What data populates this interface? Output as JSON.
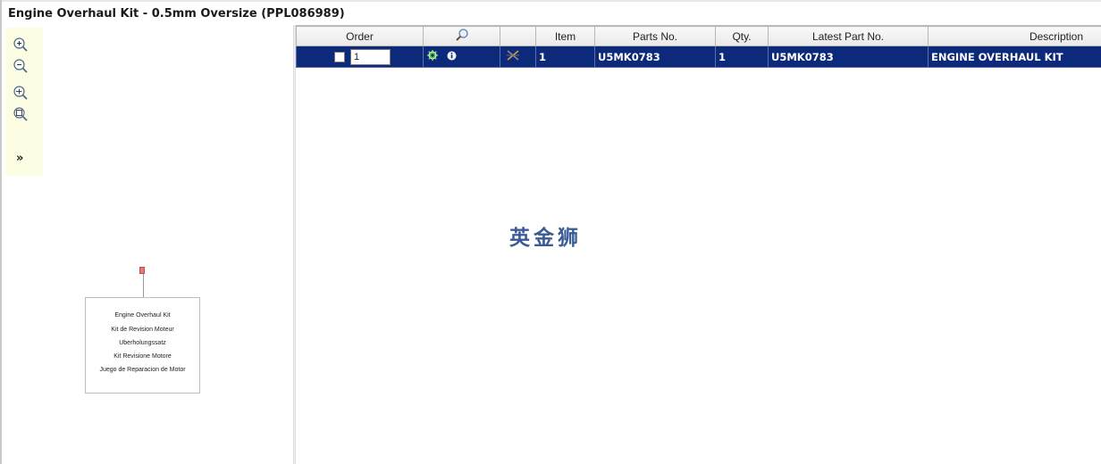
{
  "title": "Engine Overhaul Kit - 0.5mm Oversize (PPL086989)",
  "toolbar": {
    "tools": [
      "zoom-in-icon",
      "zoom-out-icon",
      "zoom-fit-icon",
      "zoom-reset-icon"
    ],
    "expand_label": "»"
  },
  "diagram": {
    "label_lines": [
      "Engine Overhaul Kit",
      "Kit de Revision Moteur",
      "Uberholungssatz",
      "Kit Revisione Motore",
      "Juego de Reparacion de Motor"
    ]
  },
  "table": {
    "headers": {
      "order": "Order",
      "search": "",
      "tools": "",
      "item": "Item",
      "parts_no": "Parts No.",
      "qty": "Qty.",
      "latest_part_no": "Latest Part No.",
      "description": "Description"
    },
    "rows": [
      {
        "order_qty": "1",
        "item": "1",
        "parts_no": "U5MK0783",
        "qty": "1",
        "latest_part_no": "U5MK0783",
        "description": "ENGINE OVERHAUL KIT"
      }
    ],
    "row_color": "#0d2a7a"
  },
  "watermark": "英金狮"
}
